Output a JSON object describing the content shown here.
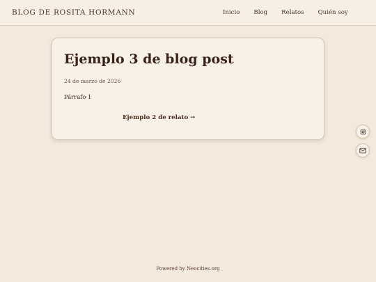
{
  "header": {
    "brand": "BLOG DE ROSITA HORMANN",
    "nav": [
      {
        "label": "Inicio"
      },
      {
        "label": "Blog"
      },
      {
        "label": "Relatos"
      },
      {
        "label": "Quién soy"
      }
    ]
  },
  "post": {
    "title": "Ejemplo 3 de blog post",
    "date": "24 de marzo de 2026",
    "paragraph": "Párrafo 1",
    "next_link": "Ejemplo 2 de relato →"
  },
  "social": {
    "icons": [
      "instagram-icon",
      "email-icon"
    ]
  },
  "footer": {
    "text": "Powered by Neocities.org"
  },
  "colors": {
    "background": "#f4e9dd",
    "card": "#f8f1e8",
    "text": "#3d2718"
  }
}
